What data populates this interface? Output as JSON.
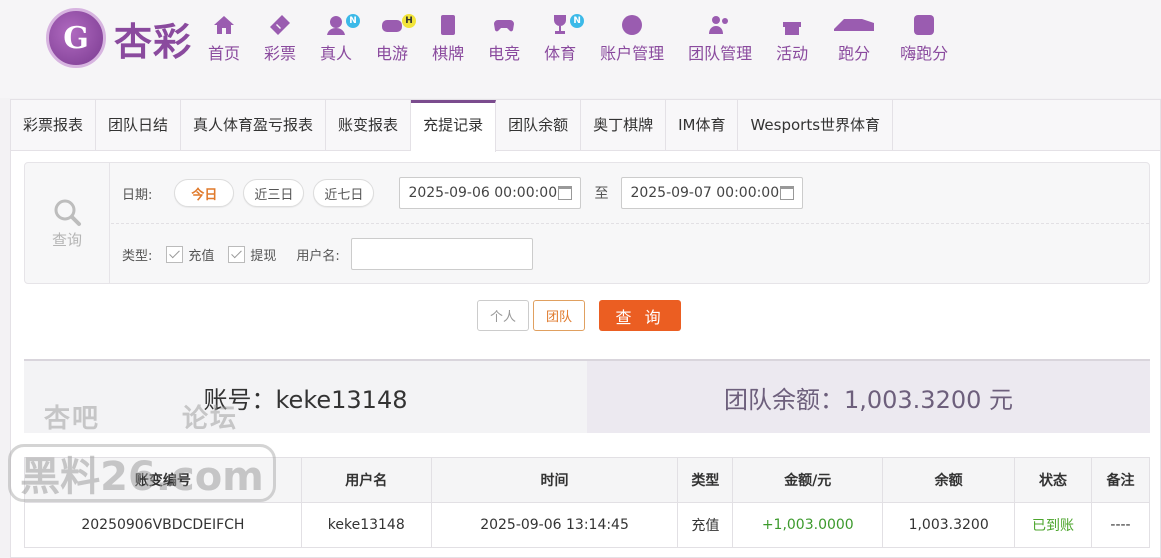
{
  "brand": {
    "logo_letter": "G",
    "name": "杏彩"
  },
  "nav": [
    {
      "label": "首页",
      "icon": "home-icon"
    },
    {
      "label": "彩票",
      "icon": "ticket-icon"
    },
    {
      "label": "真人",
      "icon": "live-dealer-icon",
      "badge": "N"
    },
    {
      "label": "电游",
      "icon": "gamepad-icon",
      "badge": "H"
    },
    {
      "label": "棋牌",
      "icon": "cards-icon"
    },
    {
      "label": "电竞",
      "icon": "esports-controller-icon"
    },
    {
      "label": "体育",
      "icon": "trophy-icon",
      "badge": "N"
    },
    {
      "label": "账户管理",
      "icon": "account-coin-icon"
    },
    {
      "label": "团队管理",
      "icon": "team-icon"
    },
    {
      "label": "活动",
      "icon": "gift-icon"
    },
    {
      "label": "跑分",
      "icon": "race-icon"
    },
    {
      "label": "嗨跑分",
      "icon": "hi-app-icon"
    }
  ],
  "tabs": [
    "彩票报表",
    "团队日结",
    "真人体育盈亏报表",
    "账变报表",
    "充提记录",
    "团队余额",
    "奥丁棋牌",
    "IM体育",
    "Wesports世界体育"
  ],
  "active_tab": 4,
  "filter": {
    "side_label": "查询",
    "date_label": "日期:",
    "quick_ranges": [
      "今日",
      "近三日",
      "近七日"
    ],
    "start_date": "2025-09-06 00:00:00",
    "to_label": "至",
    "end_date": "2025-09-07 00:00:00",
    "type_label": "类型:",
    "type_options": [
      "充值",
      "提现"
    ],
    "username_label": "用户名:",
    "username_value": ""
  },
  "buttons": {
    "personal": "个人",
    "team": "团队",
    "query": "查 询"
  },
  "summary": {
    "account_text": "账号：keke13148",
    "balance_text": "团队余额：1,003.3200 元"
  },
  "table": {
    "headers": [
      "账变编号",
      "用户名",
      "时间",
      "类型",
      "金额/元",
      "余额",
      "状态",
      "备注"
    ],
    "rows": [
      [
        "20250906VBDCDEIFCH",
        "keke13148",
        "2025-09-06 13:14:45",
        "充值",
        "+1,003.0000",
        "1,003.3200",
        "已到账",
        "----"
      ]
    ]
  },
  "watermark": {
    "top_left": "杏吧",
    "top_right": "论坛",
    "main": "黑料26.com"
  },
  "colors": {
    "accent": "#8a4a9e",
    "primary_button": "#eb5e22",
    "positive": "#3c9a2c"
  }
}
